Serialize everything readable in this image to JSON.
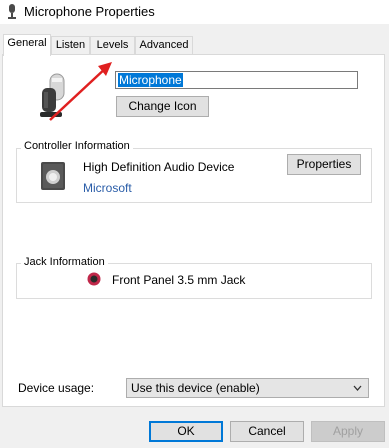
{
  "window": {
    "title": "Microphone Properties"
  },
  "tabs": [
    {
      "label": "General",
      "active": true
    },
    {
      "label": "Listen",
      "active": false
    },
    {
      "label": "Levels",
      "active": false
    },
    {
      "label": "Advanced",
      "active": false
    }
  ],
  "device": {
    "name_value": "Microphone",
    "change_icon_label": "Change Icon",
    "icon": "microphone-icon"
  },
  "controller": {
    "group_label": "Controller Information",
    "name": "High Definition Audio Device",
    "manufacturer": "Microsoft",
    "properties_label": "Properties",
    "icon": "speaker-icon"
  },
  "jack": {
    "group_label": "Jack Information",
    "text": "Front Panel 3.5 mm Jack",
    "icon": "jack-icon",
    "jack_color": "#c0284a"
  },
  "usage": {
    "label": "Device usage:",
    "selected": "Use this device (enable)"
  },
  "footer": {
    "ok_label": "OK",
    "cancel_label": "Cancel",
    "apply_label": "Apply"
  },
  "colors": {
    "accent": "#0078d7",
    "annotation_arrow": "#e02020",
    "link": "#2a5da8"
  }
}
